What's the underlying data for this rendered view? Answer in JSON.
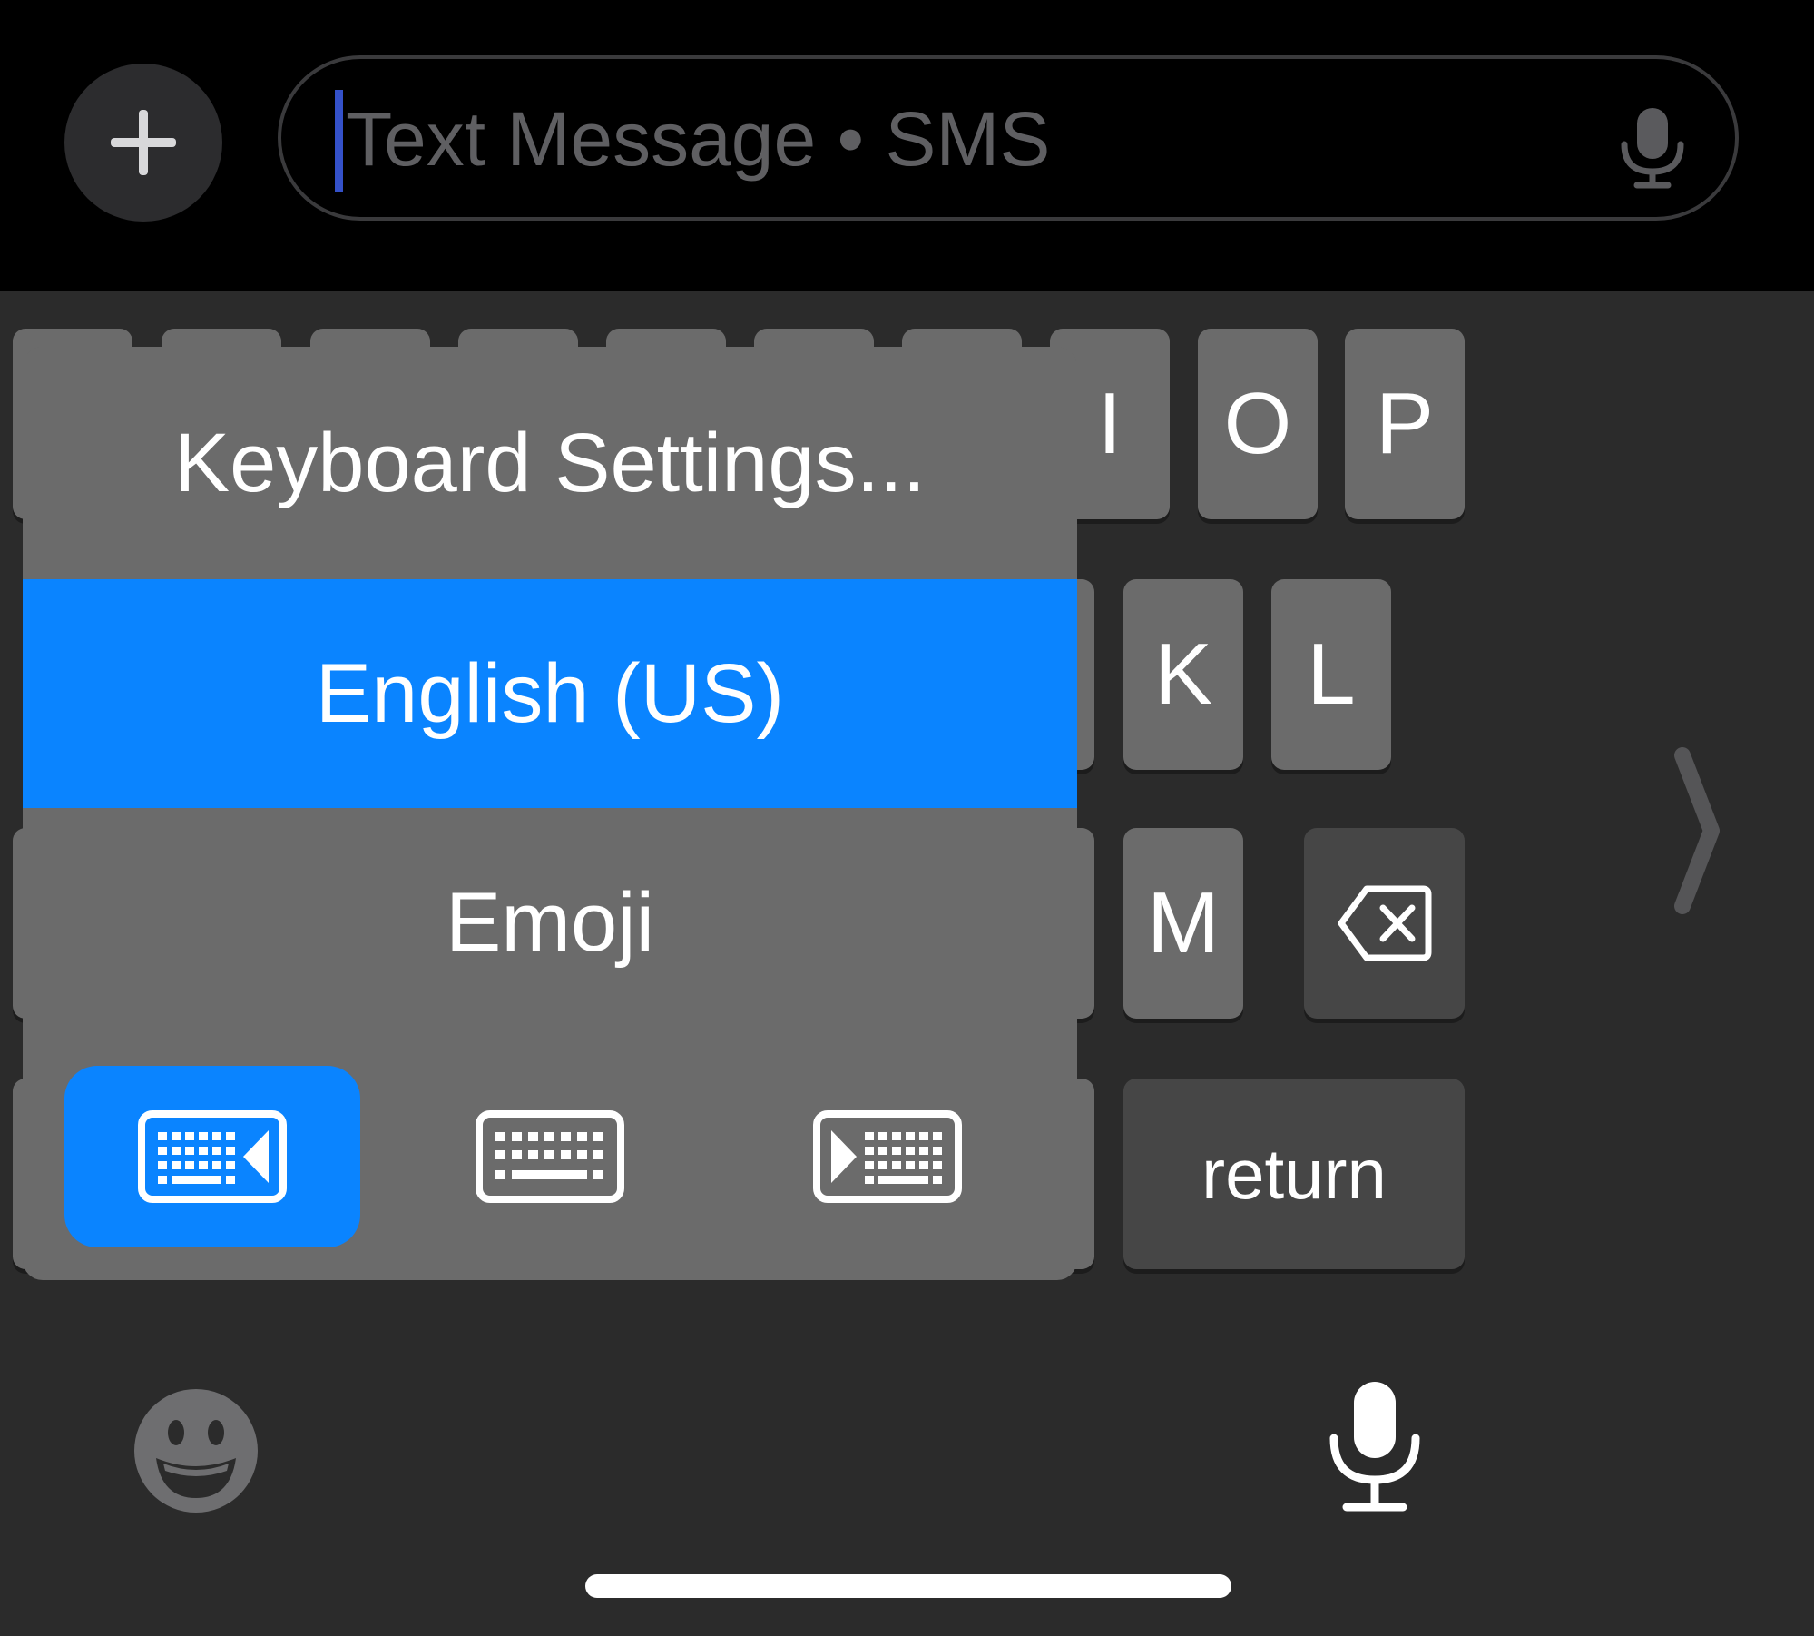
{
  "compose": {
    "placeholder": "Text Message • SMS",
    "plus_icon": "plus-icon",
    "mic_icon": "microphone-icon"
  },
  "keyboard": {
    "visible_keys": [
      "I",
      "O",
      "P",
      "K",
      "L",
      "M"
    ],
    "return_label": "return",
    "delete_icon": "delete-backward-icon",
    "chevron_icon": "chevron-right-icon",
    "emoji_icon": "emoji-smiley-icon",
    "dictation_icon": "microphone-icon"
  },
  "popover": {
    "items": [
      {
        "label": "Keyboard Settings..."
      },
      {
        "label": "English (US)",
        "selected": true
      },
      {
        "label": "Emoji"
      }
    ],
    "layout_options": [
      {
        "icon": "keyboard-left-icon",
        "selected": true
      },
      {
        "icon": "keyboard-icon",
        "selected": false
      },
      {
        "icon": "keyboard-right-icon",
        "selected": false
      }
    ]
  },
  "colors": {
    "accent": "#0a84ff",
    "key": "#6b6b6b",
    "keyboard_background": "#2b2b2b"
  }
}
